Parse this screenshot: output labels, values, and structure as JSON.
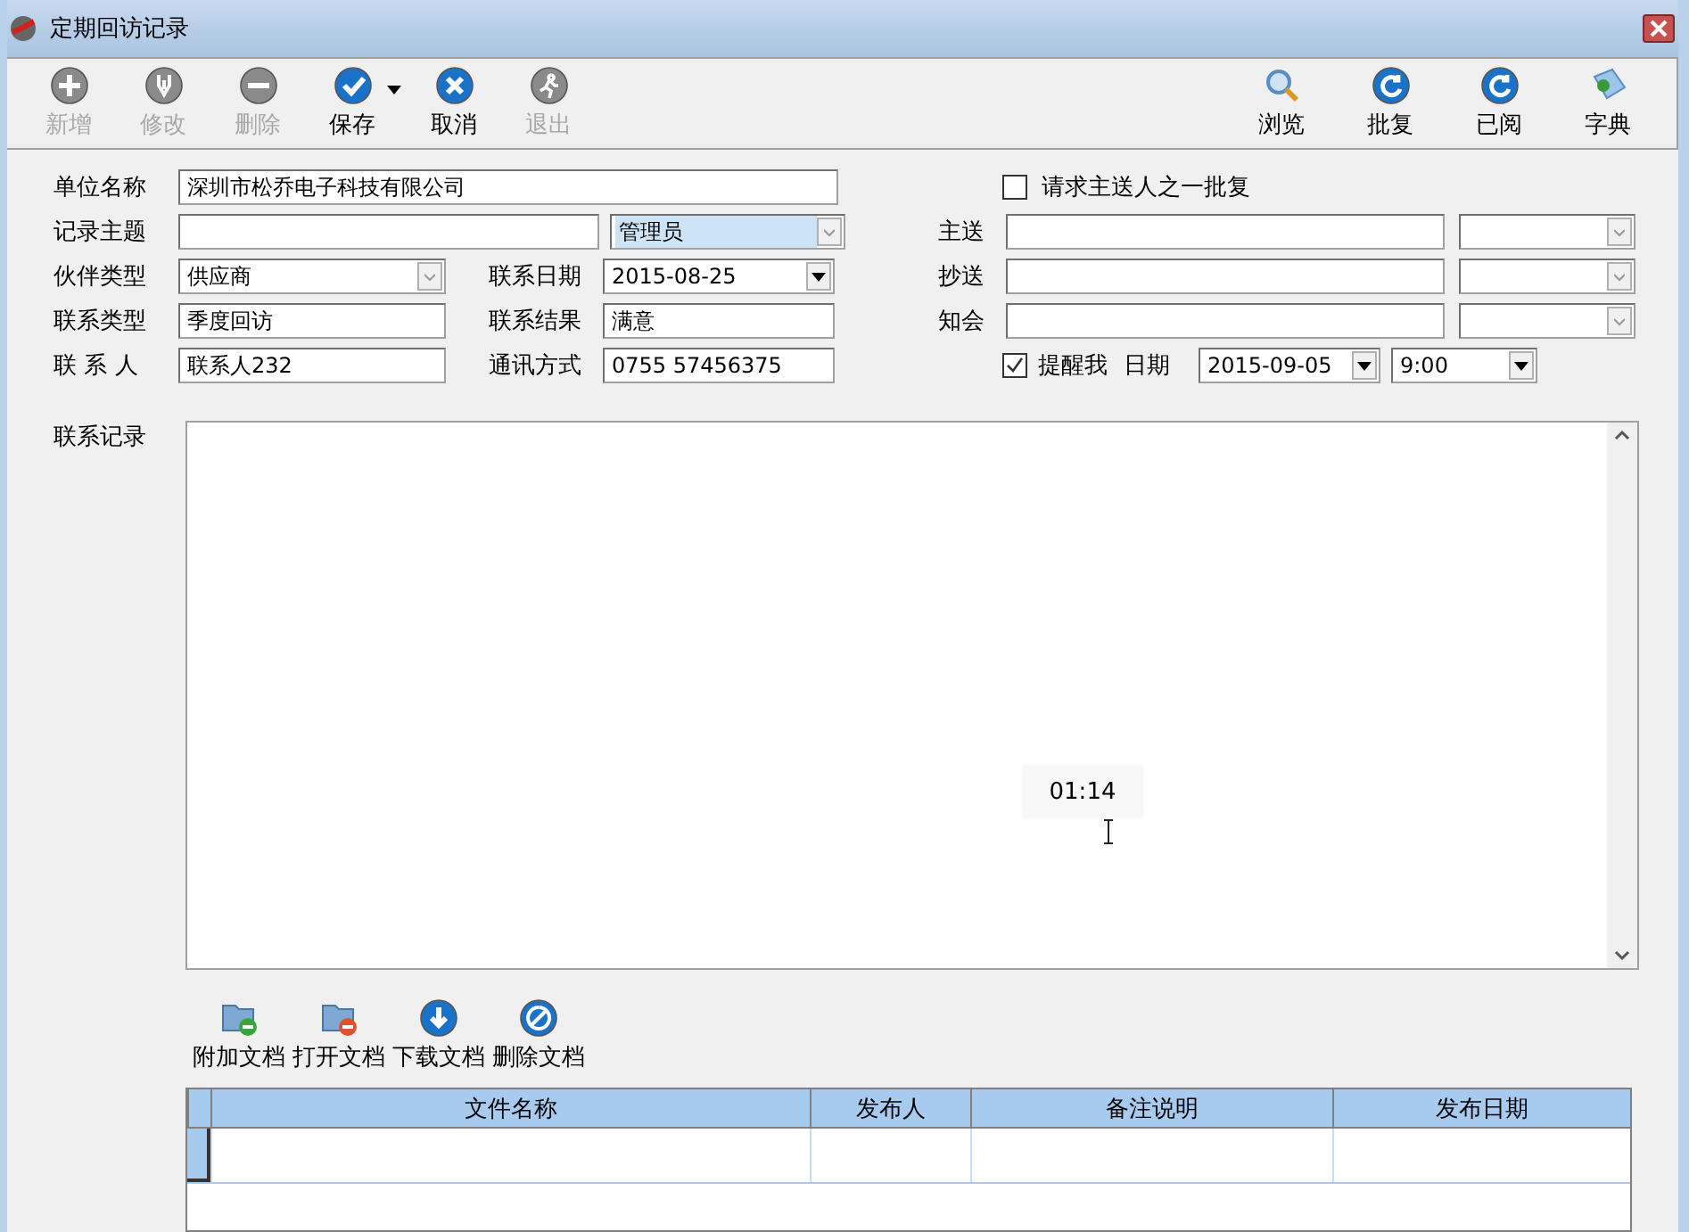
{
  "window": {
    "title": "定期回访记录"
  },
  "toolbar_left": [
    {
      "label": "新增",
      "disabled": true,
      "dropdown": false
    },
    {
      "label": "修改",
      "disabled": true,
      "dropdown": false
    },
    {
      "label": "删除",
      "disabled": true,
      "dropdown": false
    },
    {
      "label": "保存",
      "disabled": false,
      "dropdown": true
    },
    {
      "label": "取消",
      "disabled": false,
      "dropdown": false
    },
    {
      "label": "退出",
      "disabled": true,
      "dropdown": false
    }
  ],
  "toolbar_right": [
    {
      "label": "浏览"
    },
    {
      "label": "批复"
    },
    {
      "label": "已阅"
    },
    {
      "label": "字典"
    }
  ],
  "form_left": [
    {
      "label": "单位名称",
      "fields": [
        {
          "kind": "text",
          "value": "深圳市松乔电子科技有限公司"
        }
      ]
    },
    {
      "label": "记录主题",
      "fields": [
        {
          "kind": "text"
        },
        {
          "kind": "combo",
          "value": "管理员",
          "selected": true
        }
      ]
    },
    {
      "label": "伙伴类型",
      "fields": [
        {
          "kind": "combo",
          "value": "供应商",
          "selected": false
        }
      ],
      "label2": "联系日期",
      "fields2": [
        {
          "kind": "date",
          "value": "2015-08-25"
        }
      ]
    },
    {
      "label": "联系类型",
      "fields": [
        {
          "kind": "text",
          "value": "季度回访"
        }
      ],
      "label2": "联系结果",
      "fields2": [
        {
          "kind": "text",
          "value": "满意"
        }
      ]
    },
    {
      "label": "联 系 人",
      "fields": [
        {
          "kind": "text",
          "value": "联系人232"
        }
      ],
      "label2": "通讯方式",
      "fields2": [
        {
          "kind": "text",
          "value": "0755 57456375"
        }
      ]
    }
  ],
  "approval_checkbox": {
    "label": "请求主送人之一批复",
    "checked": false
  },
  "recipients": [
    {
      "label": "主送"
    },
    {
      "label": "抄送"
    },
    {
      "label": "知会"
    }
  ],
  "reminder": {
    "label": "提醒我",
    "checked": true,
    "date_label": "日期",
    "date": "2015-09-05",
    "time": "9:00"
  },
  "record": {
    "label": "联系记录",
    "tooltip": "01:14"
  },
  "doc_buttons": [
    {
      "label": "附加文档"
    },
    {
      "label": "打开文档"
    },
    {
      "label": "下载文档"
    },
    {
      "label": "删除文档"
    }
  ],
  "table": {
    "columns": [
      "文件名称",
      "发布人",
      "备注说明",
      "发布日期"
    ]
  }
}
